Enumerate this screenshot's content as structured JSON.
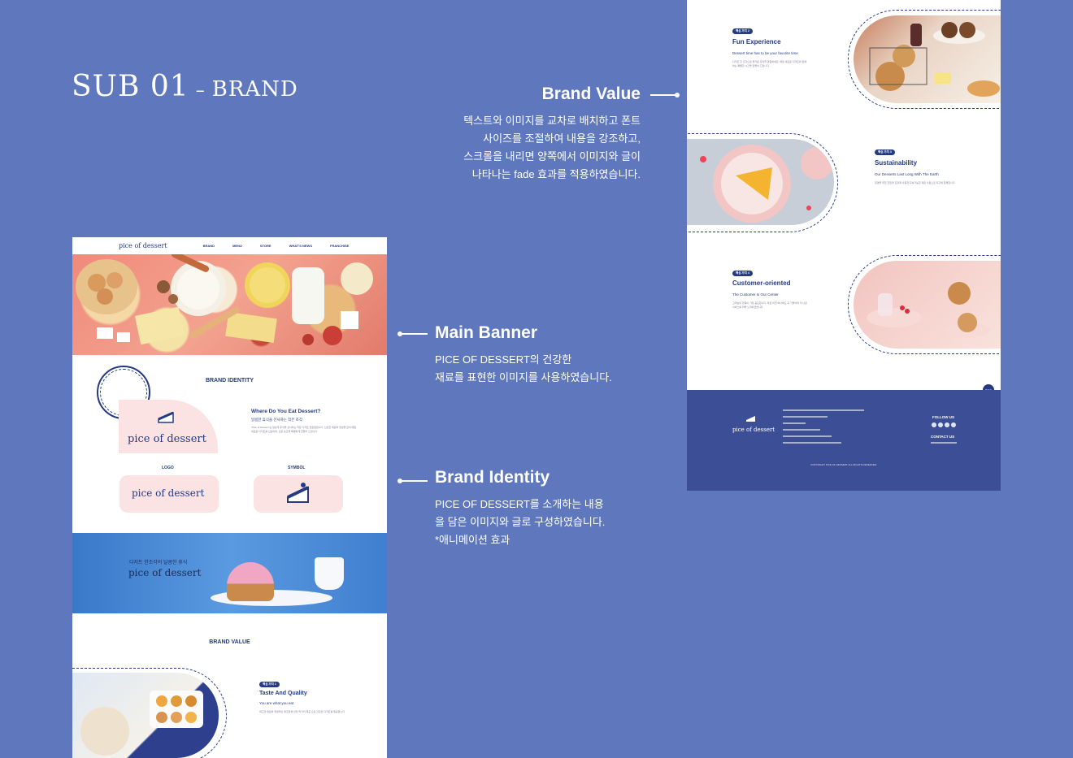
{
  "page_title": {
    "main": "SUB 01",
    "separator": "–",
    "sub": "BRAND"
  },
  "callouts": {
    "brand_value": {
      "heading": "Brand Value",
      "body": "텍스트와 이미지를 교차로 배치하고 폰트\n사이즈를 조절하여 내용을 강조하고,\n스크롤을 내리면 양쪽에서 이미지와 글이\n나타나는 fade 효과를 적용하였습니다."
    },
    "main_banner": {
      "heading": "Main Banner",
      "body": "PICE OF DESSERT의 건강한\n재료를 표현한 이미지를 사용하였습니다."
    },
    "brand_identity": {
      "heading": "Brand Identity",
      "body": "PICE OF DESSERT를 소개하는 내용\n을 담은 이미지와 글로 구성하였습니다.\n*애니메이션 효과"
    }
  },
  "left_mock": {
    "nav": {
      "logo": "pice of dessert",
      "items": [
        "BRAND",
        "MENU",
        "STORE",
        "WHAT'S NEWS",
        "FRANCHISE"
      ]
    },
    "brand_identity_title": "BRAND IDENTITY",
    "stamp_text": "PICE OF DESSERT PICE OF DESSERT",
    "big_logo": "pice of dessert",
    "identity": {
      "heading": "Where Do You Eat Dessert?",
      "subheading": "달콤한 휴식을 선사하는 작은 조각",
      "body": "\"Pice of Dessert\"는 일상의 휴식을 선사하는 작은 디저트 전문점입니다. 신선한 재료와 정성을 담아 매일 새로운 디저트를 선보이며, 모든 순간을 특별하게 만들어 드립니다."
    },
    "logo_label": "LOGO",
    "symbol_label": "SYMBOL",
    "logo_card_text": "pice of dessert",
    "banner2": {
      "kicker": "디저트 한조각의 달콤한 휴식",
      "logo": "pice of dessert"
    },
    "brand_value_title": "BRAND VALUE",
    "value1": {
      "tag": "핵심 가치 1",
      "heading": "Taste And Quality",
      "subheading": "You are what you eat",
      "body": "최고급 재료와 위생적인 제조환경 안전 먹거리 제공 으로 건강한 디저트를 제공합니다."
    }
  },
  "right_mock": {
    "value2": {
      "tag": "핵심 가치 2",
      "heading": "Fun Experience",
      "subheading": "Dessert time has to be your favorite time",
      "body": "디저트 한 조각으로 즐거운 휴식을 경험하세요. 매일 새로운 디저트와 함께하는 특별한 시간을 만들어 드립니다."
    },
    "value3": {
      "tag": "핵심 가치 3",
      "heading": "Sustainability",
      "subheading": "Our Desserts Last Long With The Earth",
      "body": "환경을 위한 친환경 포장재 사용과 지속가능한 재료 사용으로 지구와 함께합니다."
    },
    "value4": {
      "tag": "핵심 가치 4",
      "heading": "Customer-oriented",
      "subheading": "The Customer Is Our Center",
      "body": "고객님의 만족이 가장 중요합니다. 작은 의견 하나에도 귀 기울이며 더 나은 서비스를 위해 노력하겠습니다."
    },
    "top_button": "TOP",
    "footer": {
      "logo": "pice of dessert",
      "follow_us": "FOLLOW US",
      "contact_us": "CONTACT US",
      "copyright": "COPYRIGHT PICE OF DESSERT ALL RIGHTS RESERVED."
    }
  },
  "colors": {
    "background": "#5f78bd",
    "brand_navy": "#243a83",
    "pink": "#fbe3e3",
    "footer": "#3c4e96"
  }
}
